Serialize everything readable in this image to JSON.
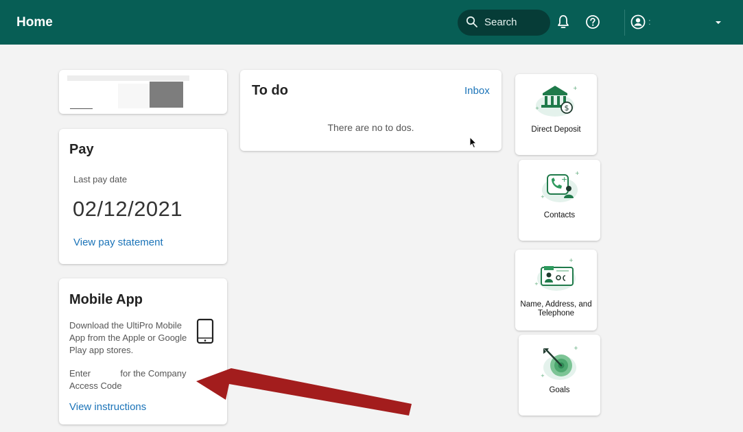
{
  "header": {
    "title": "Home",
    "search_label": "Search",
    "user_name": ":"
  },
  "pay": {
    "title": "Pay",
    "last_pay_label": "Last pay date",
    "last_pay_date": "02/12/2021",
    "link": "View pay statement"
  },
  "mobile": {
    "title": "Mobile App",
    "description": "Download the UltiPro Mobile App from the Apple or Google Play app stores.",
    "code_text": "Enter            for the Company Access Code",
    "link": "View instructions"
  },
  "todo": {
    "title": "To do",
    "inbox_link": "Inbox",
    "empty_text": "There are no to dos."
  },
  "tiles": [
    {
      "label": "Direct Deposit",
      "icon": "bank-dollar-icon"
    },
    {
      "label": "Contacts",
      "icon": "phone-contact-icon"
    },
    {
      "label": "Name, Address, and Telephone",
      "icon": "id-card-icon"
    },
    {
      "label": "Goals",
      "icon": "target-icon"
    }
  ],
  "colors": {
    "topbar": "#075e55",
    "search_bg": "#063c37",
    "link": "#1a73b8",
    "page_bg": "#f3f3f3",
    "annotation_arrow": "#a31d1d"
  }
}
